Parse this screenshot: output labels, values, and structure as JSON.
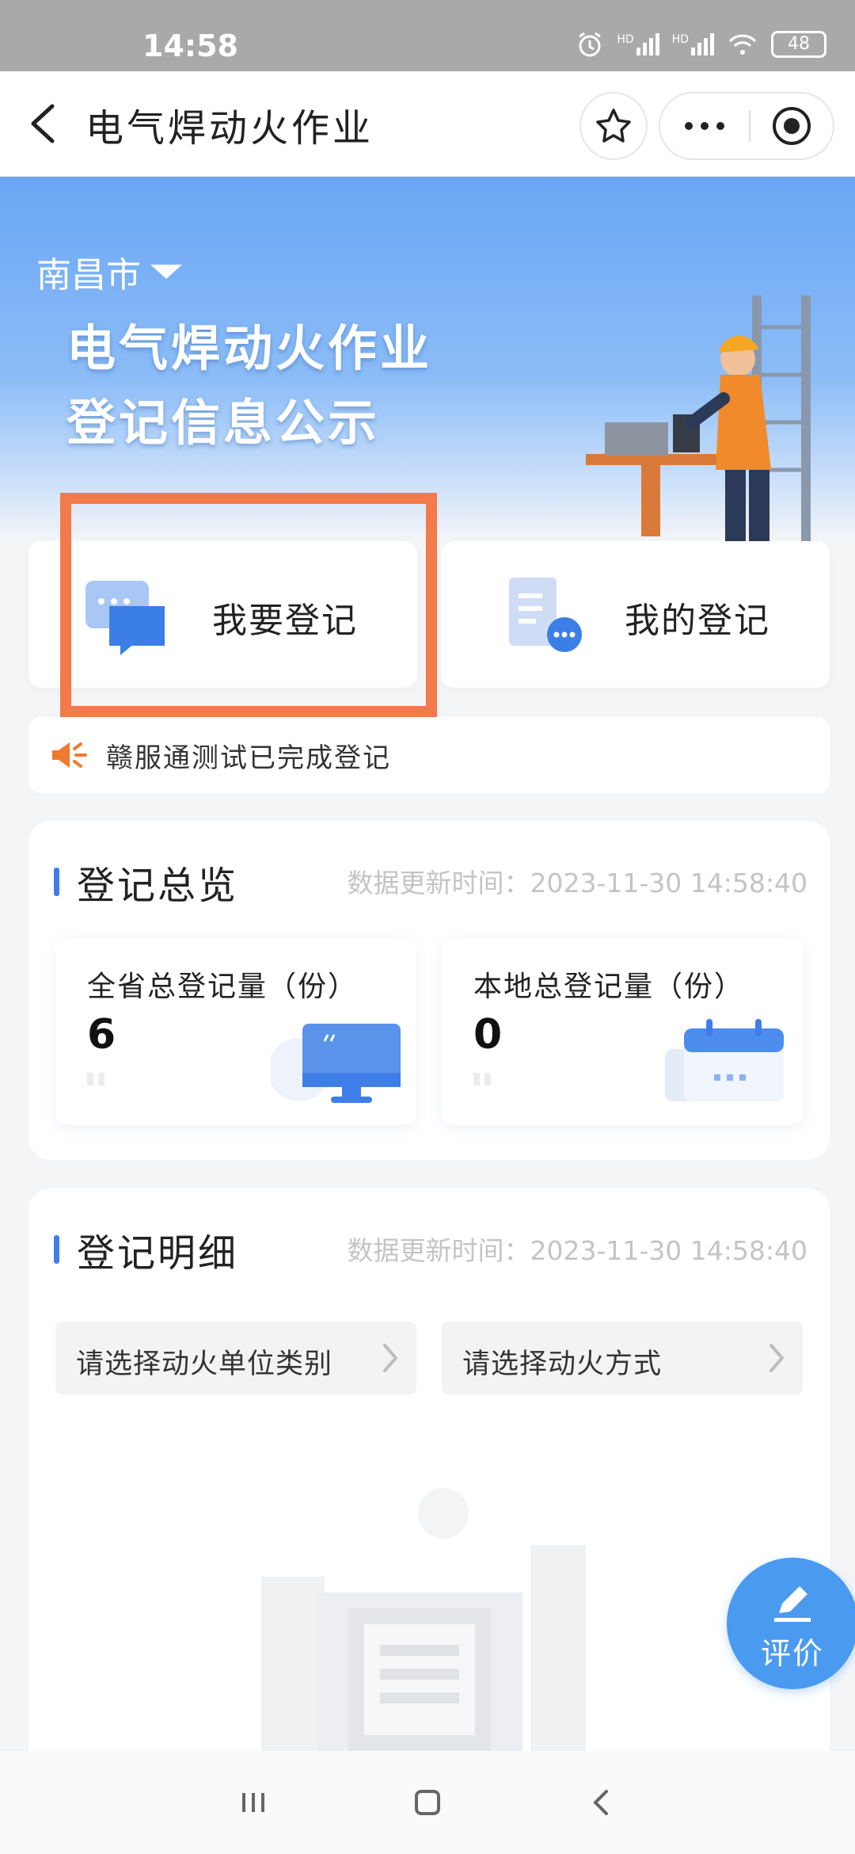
{
  "status_bar": {
    "time": "14:58",
    "hd1": "HD",
    "hd2": "HD",
    "battery": "48"
  },
  "nav": {
    "title": "电气焊动火作业"
  },
  "banner": {
    "city": "南昌市",
    "headline_line1": "电气焊动火作业",
    "headline_line2": "登记信息公示"
  },
  "actions": {
    "register": "我要登记",
    "my_register": "我的登记"
  },
  "notice": {
    "text": "赣服通测试已完成登记"
  },
  "overview": {
    "title": "登记总览",
    "update_time": "数据更新时间：2023-11-30 14:58:40",
    "province_label": "全省总登记量（份）",
    "province_value": "6",
    "local_label": "本地总登记量（份）",
    "local_value": "0"
  },
  "details": {
    "title": "登记明细",
    "update_time": "数据更新时间：2023-11-30 14:58:40",
    "filter_unit_type": "请选择动火单位类别",
    "filter_method": "请选择动火方式"
  },
  "fab": {
    "label": "评价"
  },
  "colors": {
    "accent": "#3f7ee8",
    "highlight": "#f37a4a",
    "fab": "#4a9af0"
  }
}
